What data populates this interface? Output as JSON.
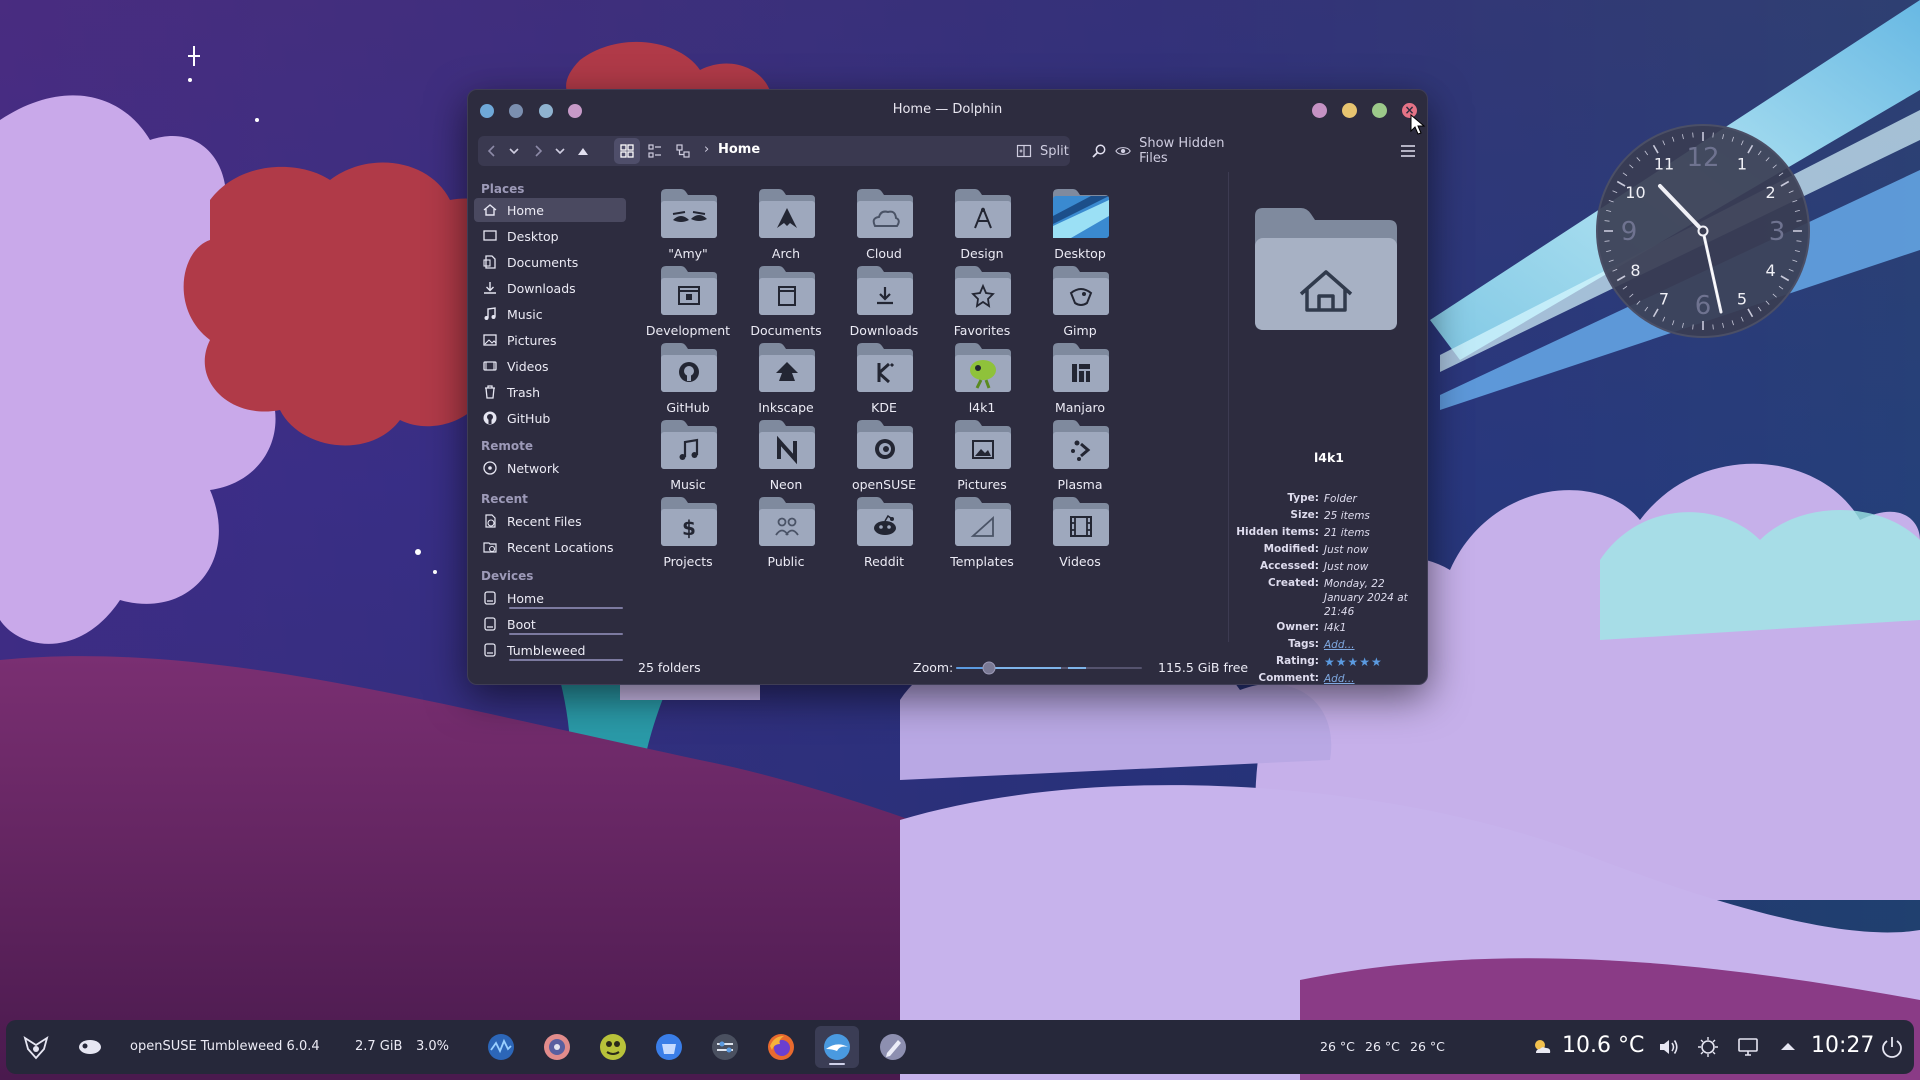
{
  "window": {
    "title": "Home — Dolphin",
    "breadcrumb": "Home",
    "split_label": "Split",
    "hidden_files_label": "Show Hidden Files"
  },
  "sidebar": {
    "sections": {
      "places": "Places",
      "remote": "Remote",
      "recent": "Recent",
      "devices": "Devices"
    },
    "places": [
      {
        "label": "Home",
        "icon": "home-icon",
        "active": true
      },
      {
        "label": "Desktop",
        "icon": "desktop-icon"
      },
      {
        "label": "Documents",
        "icon": "documents-icon"
      },
      {
        "label": "Downloads",
        "icon": "downloads-icon"
      },
      {
        "label": "Music",
        "icon": "music-icon"
      },
      {
        "label": "Pictures",
        "icon": "pictures-icon"
      },
      {
        "label": "Videos",
        "icon": "videos-icon"
      },
      {
        "label": "Trash",
        "icon": "trash-icon"
      },
      {
        "label": "GitHub",
        "icon": "github-icon"
      }
    ],
    "remote": [
      {
        "label": "Network",
        "icon": "network-icon"
      }
    ],
    "recent": [
      {
        "label": "Recent Files",
        "icon": "recent-files-icon"
      },
      {
        "label": "Recent Locations",
        "icon": "recent-locations-icon"
      }
    ],
    "devices": [
      {
        "label": "Home",
        "icon": "drive-icon"
      },
      {
        "label": "Boot",
        "icon": "drive-icon"
      },
      {
        "label": "Tumbleweed",
        "icon": "drive-icon"
      }
    ]
  },
  "folders": [
    {
      "label": "\"Amy\"",
      "icon": "eyes-icon"
    },
    {
      "label": "Arch",
      "icon": "arch-icon"
    },
    {
      "label": "Cloud",
      "icon": "cloud-icon"
    },
    {
      "label": "Design",
      "icon": "compass-icon"
    },
    {
      "label": "Desktop",
      "icon": "desktop-wallpaper-icon"
    },
    {
      "label": "Development",
      "icon": "development-icon"
    },
    {
      "label": "Documents",
      "icon": "document-icon"
    },
    {
      "label": "Downloads",
      "icon": "download-icon"
    },
    {
      "label": "Favorites",
      "icon": "star-icon"
    },
    {
      "label": "Gimp",
      "icon": "gimp-icon"
    },
    {
      "label": "GitHub",
      "icon": "github-icon"
    },
    {
      "label": "Inkscape",
      "icon": "inkscape-icon"
    },
    {
      "label": "KDE",
      "icon": "kde-icon"
    },
    {
      "label": "l4k1",
      "icon": "lizard-icon"
    },
    {
      "label": "Manjaro",
      "icon": "manjaro-icon"
    },
    {
      "label": "Music",
      "icon": "music-note-icon"
    },
    {
      "label": "Neon",
      "icon": "neon-icon"
    },
    {
      "label": "openSUSE",
      "icon": "opensuse-icon"
    },
    {
      "label": "Pictures",
      "icon": "picture-icon"
    },
    {
      "label": "Plasma",
      "icon": "plasma-icon"
    },
    {
      "label": "Projects",
      "icon": "dollar-icon"
    },
    {
      "label": "Public",
      "icon": "people-icon"
    },
    {
      "label": "Reddit",
      "icon": "reddit-icon"
    },
    {
      "label": "Templates",
      "icon": "template-icon"
    },
    {
      "label": "Videos",
      "icon": "film-icon"
    }
  ],
  "info": {
    "name": "l4k1",
    "type_k": "Type:",
    "type_v": "Folder",
    "size_k": "Size:",
    "size_v": "25 items",
    "hidden_k": "Hidden items:",
    "hidden_v": "21 items",
    "modified_k": "Modified:",
    "modified_v": "Just now",
    "accessed_k": "Accessed:",
    "accessed_v": "Just now",
    "created_k": "Created:",
    "created_v": "Monday, 22 January 2024 at 21:46",
    "owner_k": "Owner:",
    "owner_v": "l4k1",
    "tags_k": "Tags:",
    "tags_v": "Add...",
    "rating_k": "Rating:",
    "rating_stars": 5,
    "comment_k": "Comment:",
    "comment_v": "Add..."
  },
  "status": {
    "count": "25 folders",
    "zoom_label": "Zoom:",
    "zoom_fraction": 0.15,
    "free": "115.5 GiB free"
  },
  "clock": {
    "numbers": [
      "12",
      "1",
      "2",
      "3",
      "4",
      "5",
      "6",
      "7",
      "8",
      "9",
      "10",
      "11"
    ],
    "time": "10:27"
  },
  "taskbar": {
    "os_label": "openSUSE Tumbleweed 6.0.4",
    "memory": "2.7 GiB",
    "cpu": "3.0%",
    "apps": [
      "monitor-app-icon",
      "discover-app-icon",
      "lizard-app-icon",
      "shop-app-icon",
      "settings-app-icon",
      "firefox-app-icon",
      "dolphin-app-icon",
      "editor-app-icon"
    ],
    "temps": [
      "26 °C",
      "26 °C",
      "26 °C"
    ],
    "weather": "10.6 °C",
    "time": "10:27"
  },
  "colors": {
    "accent": "#5b9ae0",
    "folder": "#9ea8bd",
    "window_bg": "#2d2c3f",
    "close_btn": "#e57386"
  }
}
